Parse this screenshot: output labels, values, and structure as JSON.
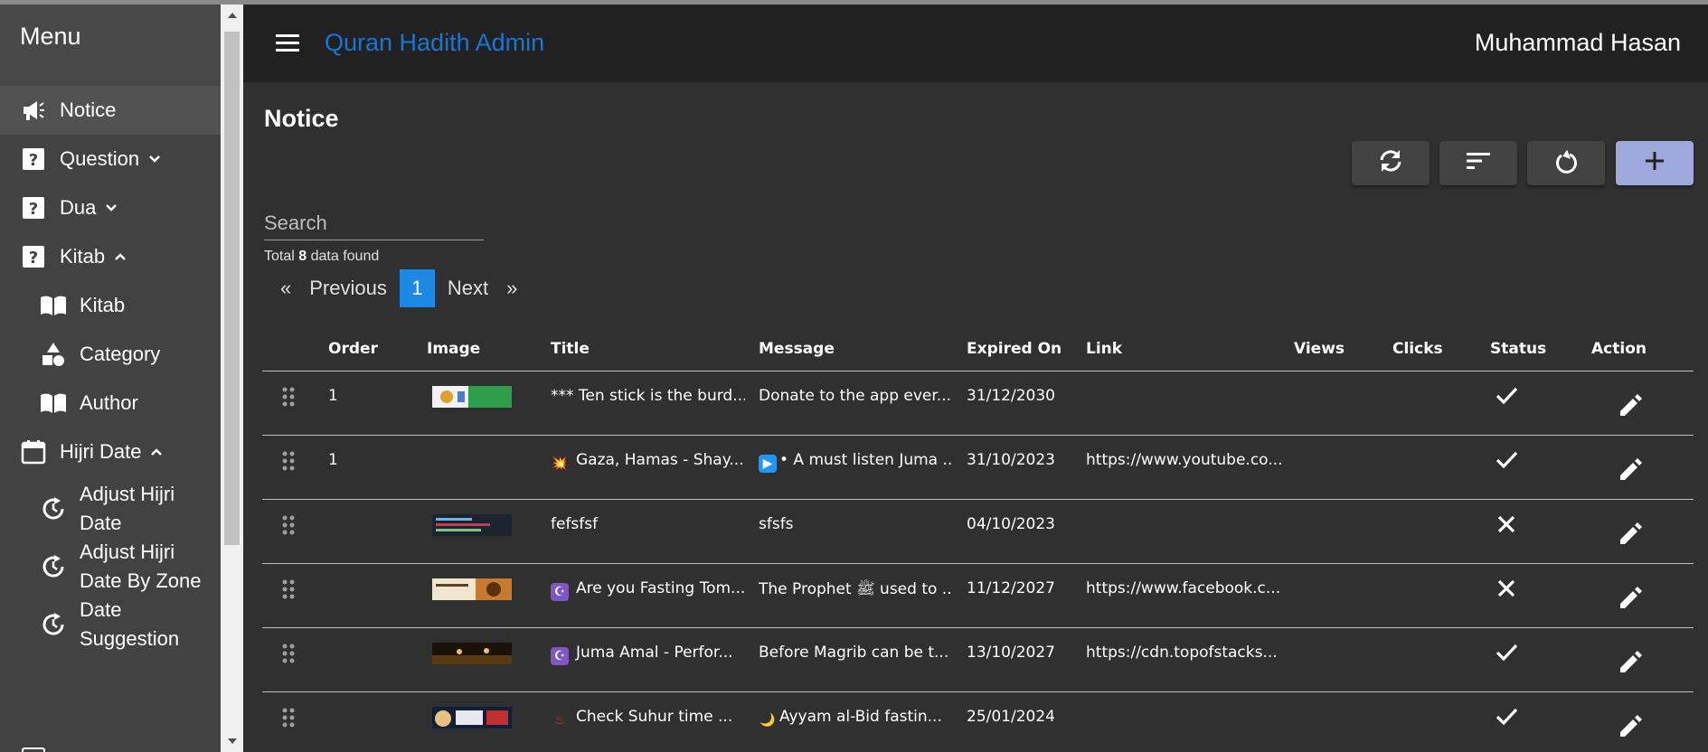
{
  "sidebar": {
    "title": "Menu",
    "items": [
      {
        "label": "Notice",
        "icon": "megaphone-icon"
      },
      {
        "label": "Question",
        "icon": "question-box-icon"
      },
      {
        "label": "Dua",
        "icon": "question-box-icon"
      },
      {
        "label": "Kitab",
        "icon": "question-box-icon"
      },
      {
        "label": "Kitab",
        "icon": "book-open-icon"
      },
      {
        "label": "Category",
        "icon": "shapes-icon"
      },
      {
        "label": "Author",
        "icon": "book-open-icon"
      },
      {
        "label": "Hijri Date",
        "icon": "calendar-icon"
      },
      {
        "label_line1": "Adjust Hijri",
        "label_line2": "Date",
        "icon": "clock-refresh-icon"
      },
      {
        "label_line1": "Adjust Hijri",
        "label_line2": "Date By Zone",
        "icon": "clock-refresh-icon"
      },
      {
        "label_line1": "Date",
        "label_line2": "Suggestion",
        "icon": "clock-refresh-icon"
      }
    ]
  },
  "header": {
    "app_title": "Quran Hadith Admin",
    "user_name": "Muhammad Hasan"
  },
  "page": {
    "title": "Notice",
    "search_placeholder": "Search",
    "total_prefix": "Total",
    "total_count": "8",
    "total_suffix": "data found"
  },
  "pager": {
    "first": "«",
    "previous": "Previous",
    "current": "1",
    "next": "Next",
    "last": "»"
  },
  "table": {
    "columns": [
      "Order",
      "Image",
      "Title",
      "Message",
      "Expired On",
      "Link",
      "Views",
      "Clicks",
      "Status",
      "Action"
    ],
    "rows": [
      {
        "order": "1",
        "has_image": true,
        "title": "*** Ten stick is the burd...",
        "message": "Donate to the app ever...",
        "expired": "31/12/2030",
        "link": "",
        "status": "active"
      },
      {
        "order": "1",
        "has_image": false,
        "title_emoji": "💥",
        "title": "Gaza, Hamas - Shay...",
        "message_emoji": "▶",
        "message": "• A must listen Juma ...",
        "expired": "31/10/2023",
        "link": "https://www.youtube.co...",
        "status": "active"
      },
      {
        "order": "",
        "has_image": true,
        "title": "fefsfsf",
        "message": "sfsfs",
        "expired": "04/10/2023",
        "link": "",
        "status": "inactive"
      },
      {
        "order": "",
        "has_image": true,
        "title_emoji": "☪",
        "title": "Are you Fasting Tom...",
        "message": "The Prophet ﷺ used to ...",
        "expired": "11/12/2027",
        "link": "https://www.facebook.c...",
        "status": "inactive"
      },
      {
        "order": "",
        "has_image": true,
        "title_emoji": "☪",
        "title": "Juma Amal - Perfor...",
        "message": "Before Magrib can be t...",
        "expired": "13/10/2027",
        "link": "https://cdn.topofstacks...",
        "status": "active"
      },
      {
        "order": "",
        "has_image": true,
        "title_emoji": "♨",
        "title": "Check Suhur time ...",
        "message_emoji": "🌙",
        "message": "Ayyam al-Bid fastin...",
        "expired": "25/01/2024",
        "link": "",
        "status": "active"
      }
    ]
  },
  "colors": {
    "accent_blue": "#1976d2",
    "primary_button": "#9fa8da",
    "page_bg": "#303030",
    "sidebar_bg": "#424242",
    "header_bg": "#212121"
  }
}
